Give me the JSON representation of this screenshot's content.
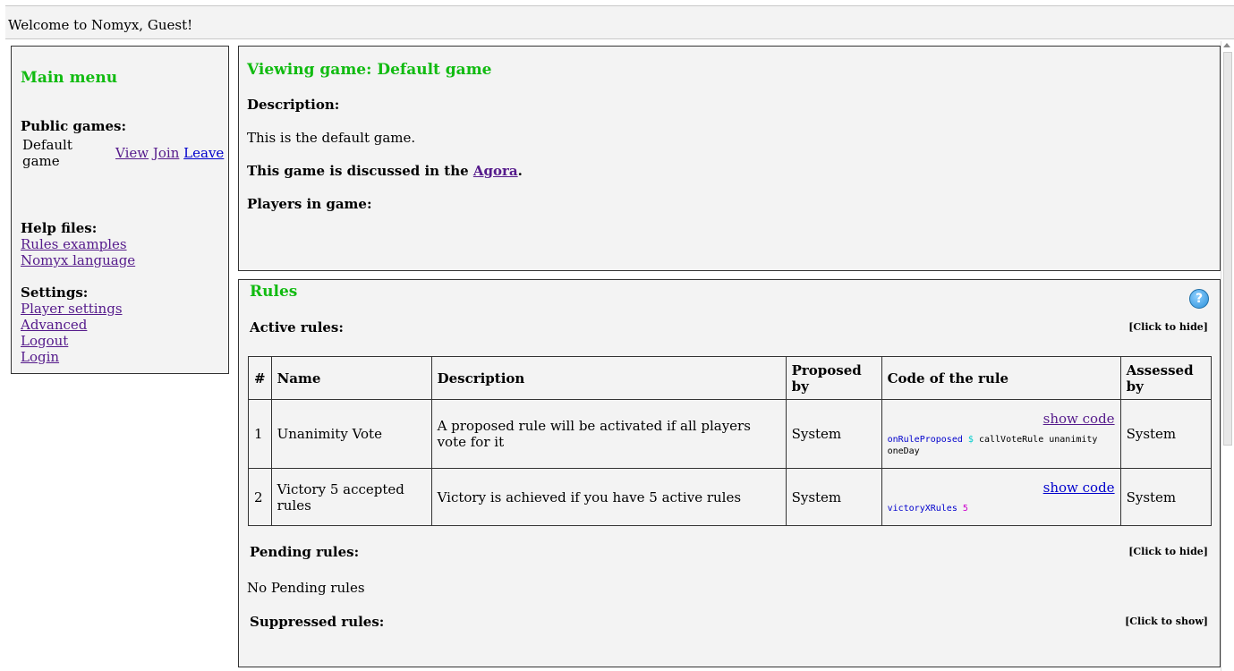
{
  "header": {
    "welcome": "Welcome to Nomyx, Guest!"
  },
  "menu": {
    "title": "Main menu",
    "public_games_label": "Public games:",
    "games": [
      {
        "name": "Default game",
        "view": "View",
        "join": "Join",
        "leave": "Leave"
      }
    ],
    "help_label": "Help files:",
    "help_links": [
      "Rules examples",
      "Nomyx language"
    ],
    "settings_label": "Settings:",
    "settings_links": [
      "Player settings",
      "Advanced",
      "Logout",
      "Login"
    ]
  },
  "game": {
    "title": "Viewing game: Default game",
    "description_label": "Description:",
    "description": "This is the default game.",
    "discussed_prefix": "This game is discussed in the ",
    "discussed_link": "Agora",
    "discussed_suffix": ".",
    "players_label": "Players in game:"
  },
  "rules": {
    "title": "Rules",
    "help_icon": "question-mark-help-icon",
    "active_label": "Active rules:",
    "active_toggle": "[Click to hide]",
    "columns": [
      "#",
      "Name",
      "Description",
      "Proposed by",
      "Code of the rule",
      "Assessed by"
    ],
    "rows": [
      {
        "num": "1",
        "name": "Unanimity Vote",
        "description": "A proposed rule will be activated if all players vote for it",
        "proposed_by": "System",
        "show_code": "show code",
        "code_fn": "onRuleProposed",
        "code_op": "$",
        "code_rest": "callVoteRule unanimity oneDay",
        "assessed_by": "System"
      },
      {
        "num": "2",
        "name": "Victory 5 accepted rules",
        "description": "Victory is achieved if you have 5 active rules",
        "proposed_by": "System",
        "show_code": "show code",
        "code_fn": "victoryXRules",
        "code_num": "5",
        "assessed_by": "System"
      }
    ],
    "pending_label": "Pending rules:",
    "pending_toggle": "[Click to hide]",
    "pending_empty": "No Pending rules",
    "suppressed_label": "Suppressed rules:",
    "suppressed_toggle": "[Click to show]"
  },
  "colors": {
    "heading_green": "#11bb11",
    "visited_link": "#551a8b",
    "link_blue": "#0000cc",
    "panel_bg": "#f3f3f3"
  }
}
